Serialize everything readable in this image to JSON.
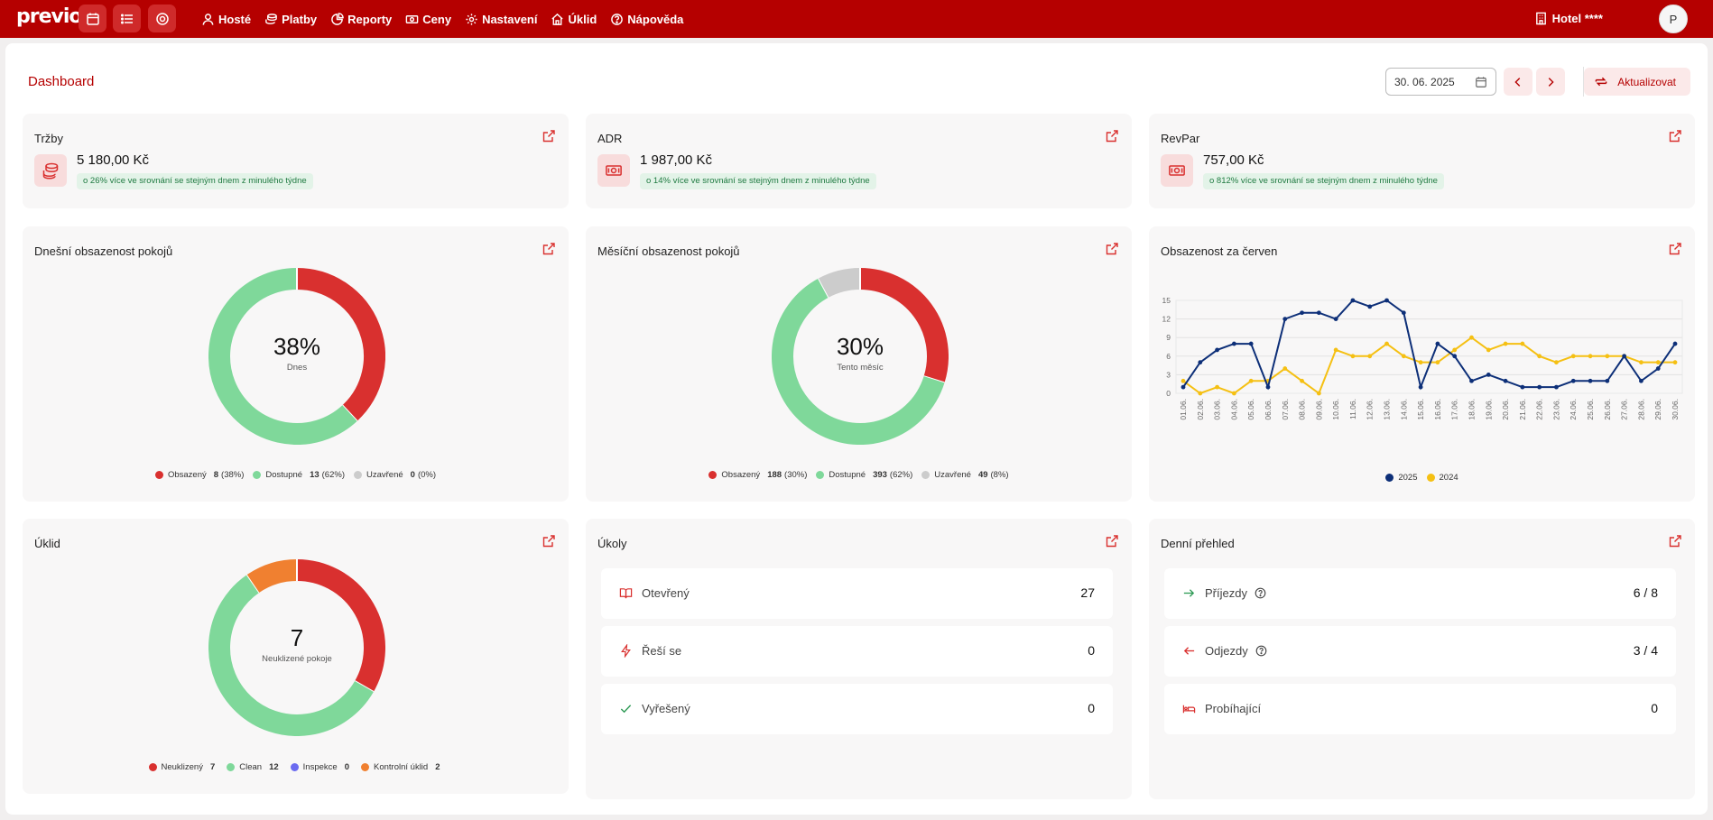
{
  "app": {
    "logo": "previo",
    "quick_buttons": [
      "calendar-icon",
      "list-icon",
      "help-circle-icon"
    ],
    "nav": [
      {
        "label": "Hosté",
        "icon": "user-icon"
      },
      {
        "label": "Platby",
        "icon": "coins-icon"
      },
      {
        "label": "Reporty",
        "icon": "pie-chart-icon"
      },
      {
        "label": "Ceny",
        "icon": "banknote-icon"
      },
      {
        "label": "Nastavení",
        "icon": "gear-icon"
      },
      {
        "label": "Úklid",
        "icon": "home-icon"
      },
      {
        "label": "Nápověda",
        "icon": "help-icon"
      }
    ],
    "hotel": "Hotel ****",
    "avatar": "P"
  },
  "page": {
    "title": "Dashboard",
    "date_value": "30. 06. 2025",
    "refresh_label": "Aktualizovat"
  },
  "kpis": [
    {
      "title": "Tržby",
      "value": "5 180,00 Kč",
      "badge": "o 26% více ve srovnání se stejným dnem z minulého týdne",
      "icon": "coins-icon"
    },
    {
      "title": "ADR",
      "value": "1 987,00 Kč",
      "badge": "o 14% více ve srovnání se stejným dnem z minulého týdne",
      "icon": "banknote-icon"
    },
    {
      "title": "RevPar",
      "value": "757,00 Kč",
      "badge": "o 812% více ve srovnání se stejným dnem z minulého týdne",
      "icon": "banknote-icon"
    }
  ],
  "today_occupancy": {
    "title": "Dnešní obsazenost pokojů",
    "center_value": "38%",
    "center_label": "Dnes",
    "legend": [
      {
        "label": "Obsazený",
        "count": "8",
        "pct": "(38%)",
        "value": 8,
        "color": "#d9302f"
      },
      {
        "label": "Dostupné",
        "count": "13",
        "pct": "(62%)",
        "value": 13,
        "color": "#7fd89a"
      },
      {
        "label": "Uzavřené",
        "count": "0",
        "pct": "(0%)",
        "value": 0,
        "color": "#cccccc"
      }
    ]
  },
  "month_occupancy": {
    "title": "Měsíční obsazenost pokojů",
    "center_value": "30%",
    "center_label": "Tento měsíc",
    "legend": [
      {
        "label": "Obsazený",
        "count": "188",
        "pct": "(30%)",
        "value": 188,
        "color": "#d9302f"
      },
      {
        "label": "Dostupné",
        "count": "393",
        "pct": "(62%)",
        "value": 393,
        "color": "#7fd89a"
      },
      {
        "label": "Uzavřené",
        "count": "49",
        "pct": "(8%)",
        "value": 49,
        "color": "#cccccc"
      }
    ]
  },
  "housekeeping": {
    "title": "Úklid",
    "center_value": "7",
    "center_label": "Neuklizené pokoje",
    "legend": [
      {
        "label": "Neuklizený",
        "count": "7",
        "value": 7,
        "color": "#d9302f"
      },
      {
        "label": "Clean",
        "count": "12",
        "value": 12,
        "color": "#7fd89a"
      },
      {
        "label": "Inspekce",
        "count": "0",
        "value": 0,
        "color": "#6b6bf0"
      },
      {
        "label": "Kontrolní úklid",
        "count": "2",
        "value": 2,
        "color": "#f08030"
      }
    ]
  },
  "chart_data": {
    "type": "line",
    "title": "Obsazenost za červen",
    "x": [
      "01.06.",
      "02.06.",
      "03.06.",
      "04.06.",
      "05.06.",
      "06.06.",
      "07.06.",
      "08.06.",
      "09.06.",
      "10.06.",
      "11.06.",
      "12.06.",
      "13.06.",
      "14.06.",
      "15.06.",
      "16.06.",
      "17.06.",
      "18.06.",
      "19.06.",
      "20.06.",
      "21.06.",
      "22.06.",
      "23.06.",
      "24.06.",
      "25.06.",
      "26.06.",
      "27.06.",
      "28.06.",
      "29.06.",
      "30.06."
    ],
    "y_ticks": [
      "0",
      "3",
      "6",
      "9",
      "12",
      "15"
    ],
    "ylim": [
      0,
      15
    ],
    "grid": true,
    "legend_position": "bottom",
    "series": [
      {
        "name": "2025",
        "color": "#0d2f78",
        "values": [
          1,
          5,
          7,
          8,
          8,
          1,
          12,
          13,
          13,
          12,
          15,
          14,
          15,
          13,
          1,
          8,
          6,
          2,
          3,
          2,
          1,
          1,
          1,
          2,
          2,
          2,
          6,
          2,
          4,
          8
        ]
      },
      {
        "name": "2024",
        "color": "#f5c013",
        "values": [
          2,
          0,
          1,
          0,
          2,
          2,
          4,
          2,
          0,
          7,
          6,
          6,
          8,
          6,
          5,
          5,
          7,
          9,
          7,
          8,
          8,
          6,
          5,
          6,
          6,
          6,
          6,
          5,
          5,
          5
        ]
      }
    ]
  },
  "tasks": {
    "title": "Úkoly",
    "rows": [
      {
        "label": "Otevřený",
        "value": "27",
        "icon": "book-open-icon"
      },
      {
        "label": "Řeší se",
        "value": "0",
        "icon": "lightning-icon"
      },
      {
        "label": "Vyřešený",
        "value": "0",
        "icon": "check-icon"
      }
    ]
  },
  "daily": {
    "title": "Denní přehled",
    "rows": [
      {
        "label": "Příjezdy",
        "value": "6 / 8",
        "icon": "arrow-right-icon"
      },
      {
        "label": "Odjezdy",
        "value": "3 / 4",
        "icon": "arrow-left-icon"
      },
      {
        "label": "Probíhající",
        "value": "0",
        "icon": "bed-icon"
      }
    ]
  }
}
